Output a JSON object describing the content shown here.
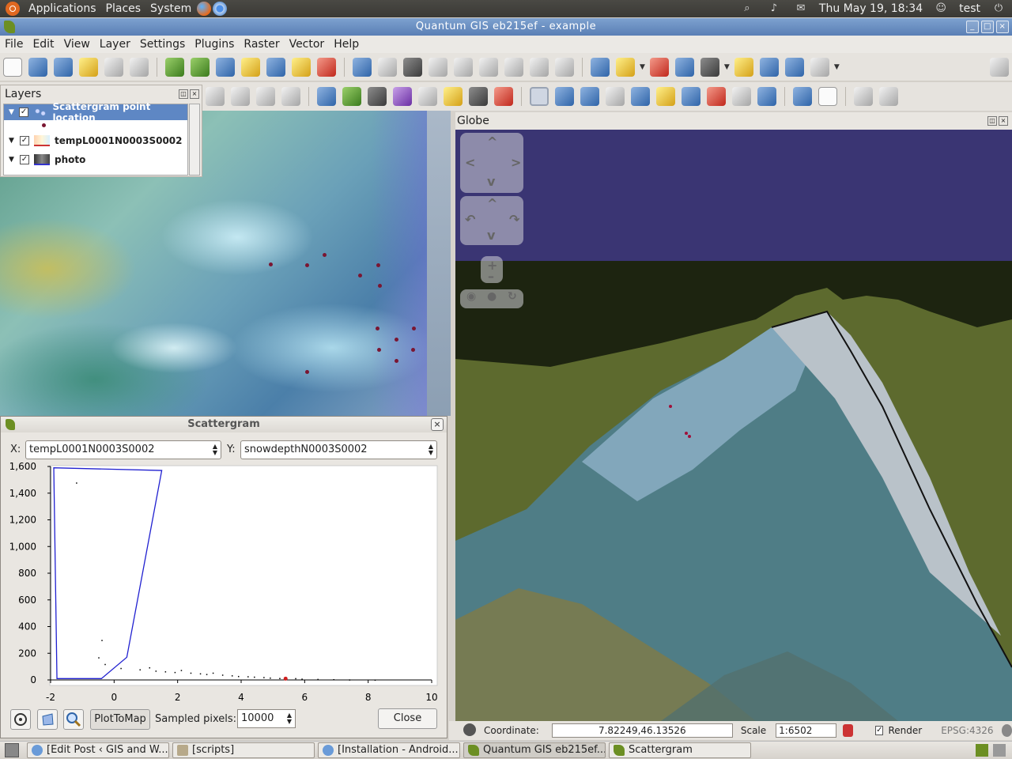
{
  "top_panel": {
    "menus": [
      "Applications",
      "Places",
      "System"
    ],
    "datetime": "Thu May 19, 18:34",
    "user": "test"
  },
  "window": {
    "title": "Quantum GIS eb215ef - example"
  },
  "menu_bar": [
    "File",
    "Edit",
    "View",
    "Layer",
    "Settings",
    "Plugins",
    "Raster",
    "Vector",
    "Help"
  ],
  "layers_panel": {
    "title": "Layers",
    "layers": [
      {
        "name": "Scattergram point location",
        "checked": true,
        "selected": true
      },
      {
        "name": "tempL0001N0003S0002",
        "checked": true,
        "selected": false
      },
      {
        "name": "photo",
        "checked": true,
        "selected": false
      }
    ]
  },
  "scattergram": {
    "title": "Scattergram",
    "x_label": "X:",
    "x_value": "tempL0001N0003S0002",
    "y_label": "Y:",
    "y_value": "snowdepthN0003S0002",
    "plot_to_map_label": "PlotToMap",
    "sampled_label": "Sampled pixels:",
    "sampled_value": "10000",
    "close_label": "Close"
  },
  "chart_data": {
    "type": "scatter",
    "xlim": [
      -2,
      10
    ],
    "ylim": [
      0,
      1600
    ],
    "x_ticks": [
      "-2",
      "0",
      "2",
      "4",
      "6",
      "8",
      "10"
    ],
    "y_ticks": [
      "0",
      "200",
      "400",
      "600",
      "800",
      "1,000",
      "1,200",
      "1,400",
      "1,600"
    ],
    "polygon": [
      [
        -1.9,
        1590
      ],
      [
        1.5,
        1570
      ],
      [
        0.4,
        170
      ],
      [
        -0.4,
        10
      ],
      [
        -1.8,
        10
      ]
    ],
    "points": [
      [
        -1.2,
        1480
      ],
      [
        -0.4,
        300
      ],
      [
        -0.5,
        170
      ],
      [
        -0.3,
        120
      ],
      [
        0.2,
        90
      ],
      [
        0.8,
        80
      ],
      [
        1.3,
        70
      ],
      [
        1.9,
        60
      ],
      [
        2.4,
        55
      ],
      [
        2.9,
        45
      ],
      [
        3.4,
        40
      ],
      [
        3.9,
        30
      ],
      [
        4.4,
        25
      ],
      [
        4.9,
        18
      ],
      [
        5.4,
        12
      ],
      [
        5.9,
        10
      ],
      [
        6.4,
        8
      ],
      [
        6.9,
        6
      ],
      [
        7.4,
        4
      ],
      [
        8.2,
        3
      ],
      [
        1.1,
        95
      ],
      [
        1.6,
        65
      ],
      [
        2.1,
        75
      ],
      [
        2.7,
        50
      ],
      [
        3.1,
        55
      ],
      [
        3.7,
        35
      ],
      [
        4.2,
        28
      ],
      [
        4.7,
        22
      ],
      [
        5.2,
        15
      ],
      [
        5.7,
        14
      ]
    ],
    "highlight_point": [
      5.4,
      10
    ]
  },
  "globe": {
    "title": "Globe"
  },
  "status_bar": {
    "coordinate_label": "Coordinate:",
    "coordinate_value": "7.82249,46.13526",
    "scale_label": "Scale",
    "scale_value": "1:6502",
    "render_label": "Render",
    "crs": "EPSG:4326"
  },
  "taskbar": [
    {
      "label": "[Edit Post ‹ GIS and W...",
      "active": false
    },
    {
      "label": "[scripts]",
      "active": false
    },
    {
      "label": "[Installation - Android...",
      "active": false
    },
    {
      "label": "Quantum GIS eb215ef...",
      "active": true
    },
    {
      "label": "Scattergram",
      "active": false
    }
  ],
  "colors": {
    "selection": "#5e87c4",
    "polygon": "#2020d0",
    "point": "#7a1632",
    "sky": "#3a3573"
  }
}
